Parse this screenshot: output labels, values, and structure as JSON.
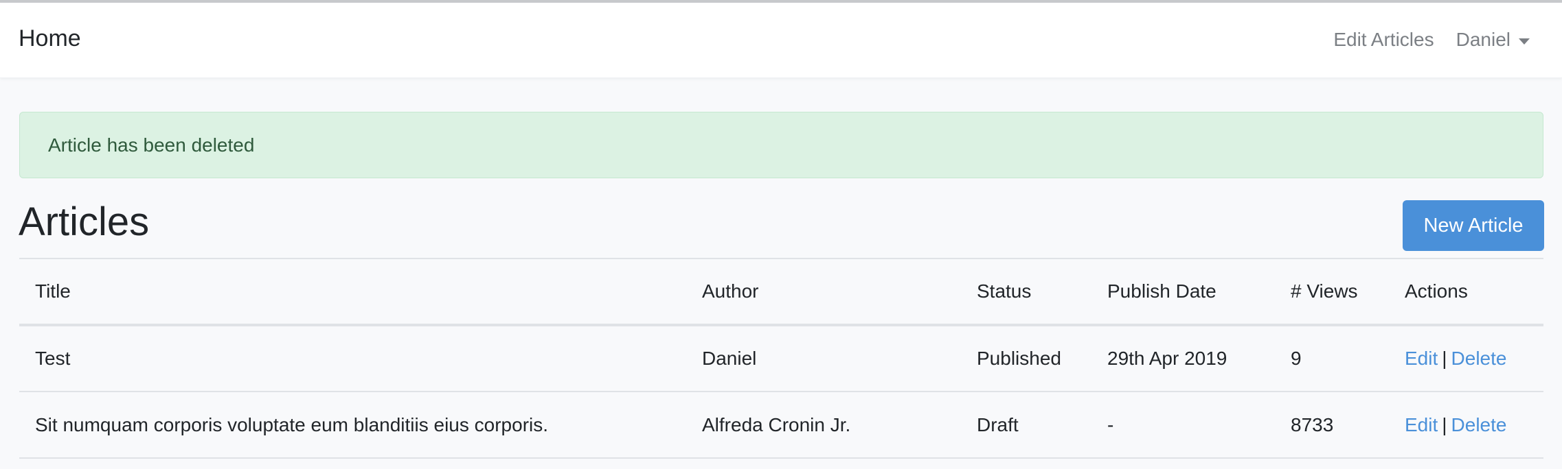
{
  "navbar": {
    "brand": "Home",
    "edit_articles": "Edit Articles",
    "user": "Daniel"
  },
  "alert": {
    "message": "Article has been deleted",
    "color": "#dcf2e3"
  },
  "page": {
    "title": "Articles",
    "new_button": "New Article",
    "accent": "#4a90d9"
  },
  "table": {
    "headers": [
      "Title",
      "Author",
      "Status",
      "Publish Date",
      "# Views",
      "Actions"
    ],
    "rows": [
      {
        "title": "Test",
        "author": "Daniel",
        "status": "Published",
        "publish_date": "29th Apr 2019",
        "views": "9",
        "edit": "Edit",
        "separator": "|",
        "delete": "Delete"
      },
      {
        "title": "Sit numquam corporis voluptate eum blanditiis eius corporis.",
        "author": "Alfreda Cronin Jr.",
        "status": "Draft",
        "publish_date": "-",
        "views": "8733",
        "edit": "Edit",
        "separator": "|",
        "delete": "Delete"
      }
    ]
  }
}
